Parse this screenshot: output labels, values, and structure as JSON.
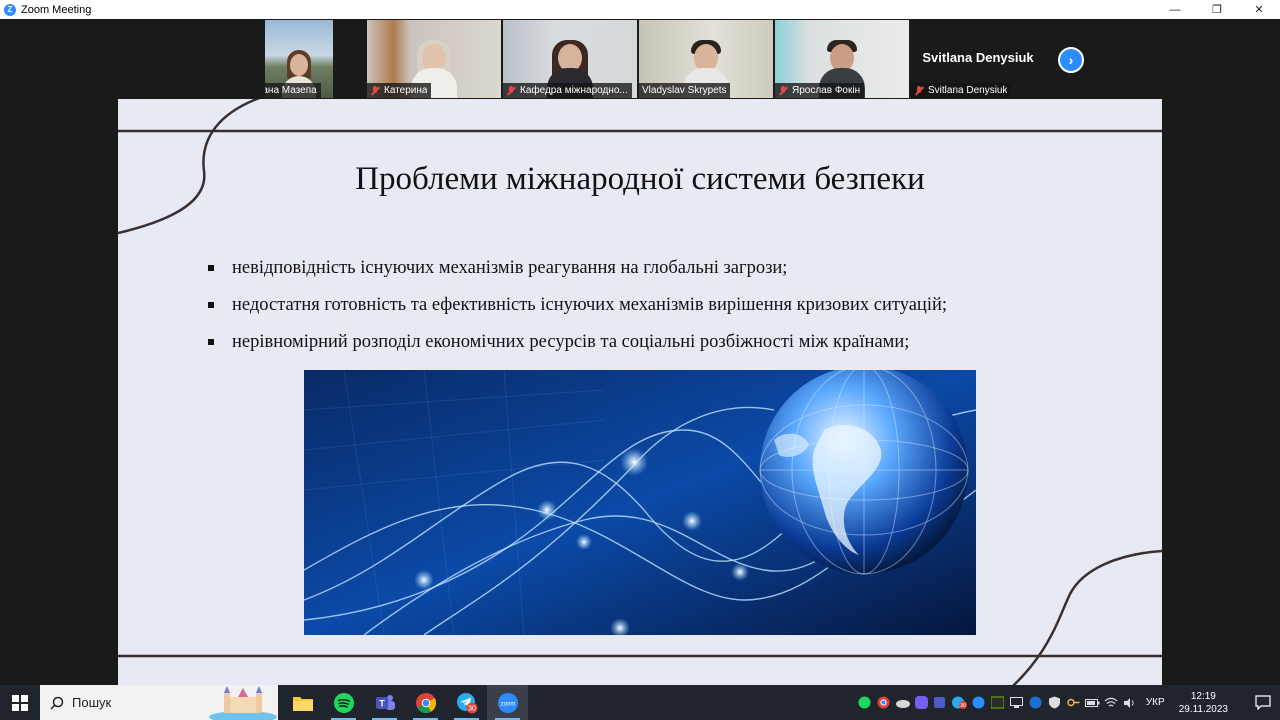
{
  "window": {
    "title": "Zoom Meeting",
    "minimize": "—",
    "maximize": "❐",
    "close": "✕"
  },
  "participants": [
    {
      "name": "Диана Мазепа",
      "muted": true,
      "type": "video",
      "small": true
    },
    {
      "name": "Катерина",
      "muted": true,
      "type": "video"
    },
    {
      "name": "Кафедра міжнародно...",
      "muted": true,
      "type": "video"
    },
    {
      "name": "Vladyslav Skrypets",
      "muted": false,
      "type": "video",
      "active": true
    },
    {
      "name": "Ярослав Фокін",
      "muted": true,
      "type": "video"
    },
    {
      "name": "Svitlana Denysiuk",
      "muted": true,
      "type": "name-only",
      "display_name": "Svitlana Denysiuk"
    }
  ],
  "gallery": {
    "next_arrow": "›"
  },
  "slide": {
    "title": "Проблеми міжнародної системи безпеки",
    "bullets": [
      "невідповідність існуючих механізмів реагування на глобальні загрози;",
      "недостатня готовність та ефективність існуючих механізмів вирішення кризових ситуацій;",
      "нерівномірний розподіл економічних ресурсів та соціальні розбіжності між країнами;"
    ]
  },
  "taskbar": {
    "search_placeholder": "Пошук",
    "apps": [
      "file-explorer",
      "spotify",
      "teams",
      "chrome",
      "telegram",
      "zoom"
    ],
    "telegram_badge": "30",
    "zoom_label": "zoom",
    "tray_badge": "30",
    "language": "УКР",
    "time": "12:19",
    "date": "29.11.2023"
  },
  "colors": {
    "accent": "#2d8cff",
    "active_speaker": "#8fd14f",
    "slide_bg": "#e8eaf3",
    "slide_line": "#3a2f2f",
    "muted_icon": "#e34848"
  }
}
